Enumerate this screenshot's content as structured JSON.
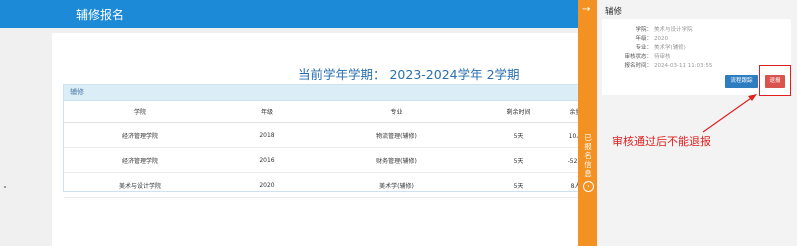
{
  "header": {
    "title": "辅修报名"
  },
  "term": {
    "text": "当前学年学期： 2023-2024学年 2学期"
  },
  "panel": {
    "title": "辅修"
  },
  "table": {
    "columns": [
      "学院",
      "年级",
      "专业",
      "剩余时间",
      "余量"
    ],
    "rows": [
      [
        "经济管理学院",
        "2018",
        "物流管理(辅修)",
        "5天",
        "10人"
      ],
      [
        "经济管理学院",
        "2016",
        "财务管理(辅修)",
        "5天",
        "-52人"
      ],
      [
        "美术与设计学院",
        "2020",
        "美术学(辅修)",
        "5天",
        "8人"
      ]
    ]
  },
  "sidebar": {
    "arrow": "→",
    "label": "已报名信息",
    "circle_glyph": "›"
  },
  "detail": {
    "title": "辅修",
    "fields": [
      {
        "k": "学院：",
        "v": "美术与设计学院"
      },
      {
        "k": "年级：",
        "v": "2020"
      },
      {
        "k": "专业：",
        "v": "美术学(辅修)"
      },
      {
        "k": "审核状态：",
        "v": "待审核"
      },
      {
        "k": "报名时间：",
        "v": "2024-03-11 11:03:55"
      }
    ],
    "btn_flow": "流程跟踪",
    "btn_withdraw": "退报"
  },
  "annotation": {
    "text": "审核通过后不能退报"
  },
  "colors": {
    "primary": "#1d8ad7",
    "accent": "#f39222",
    "danger": "#e02020"
  }
}
